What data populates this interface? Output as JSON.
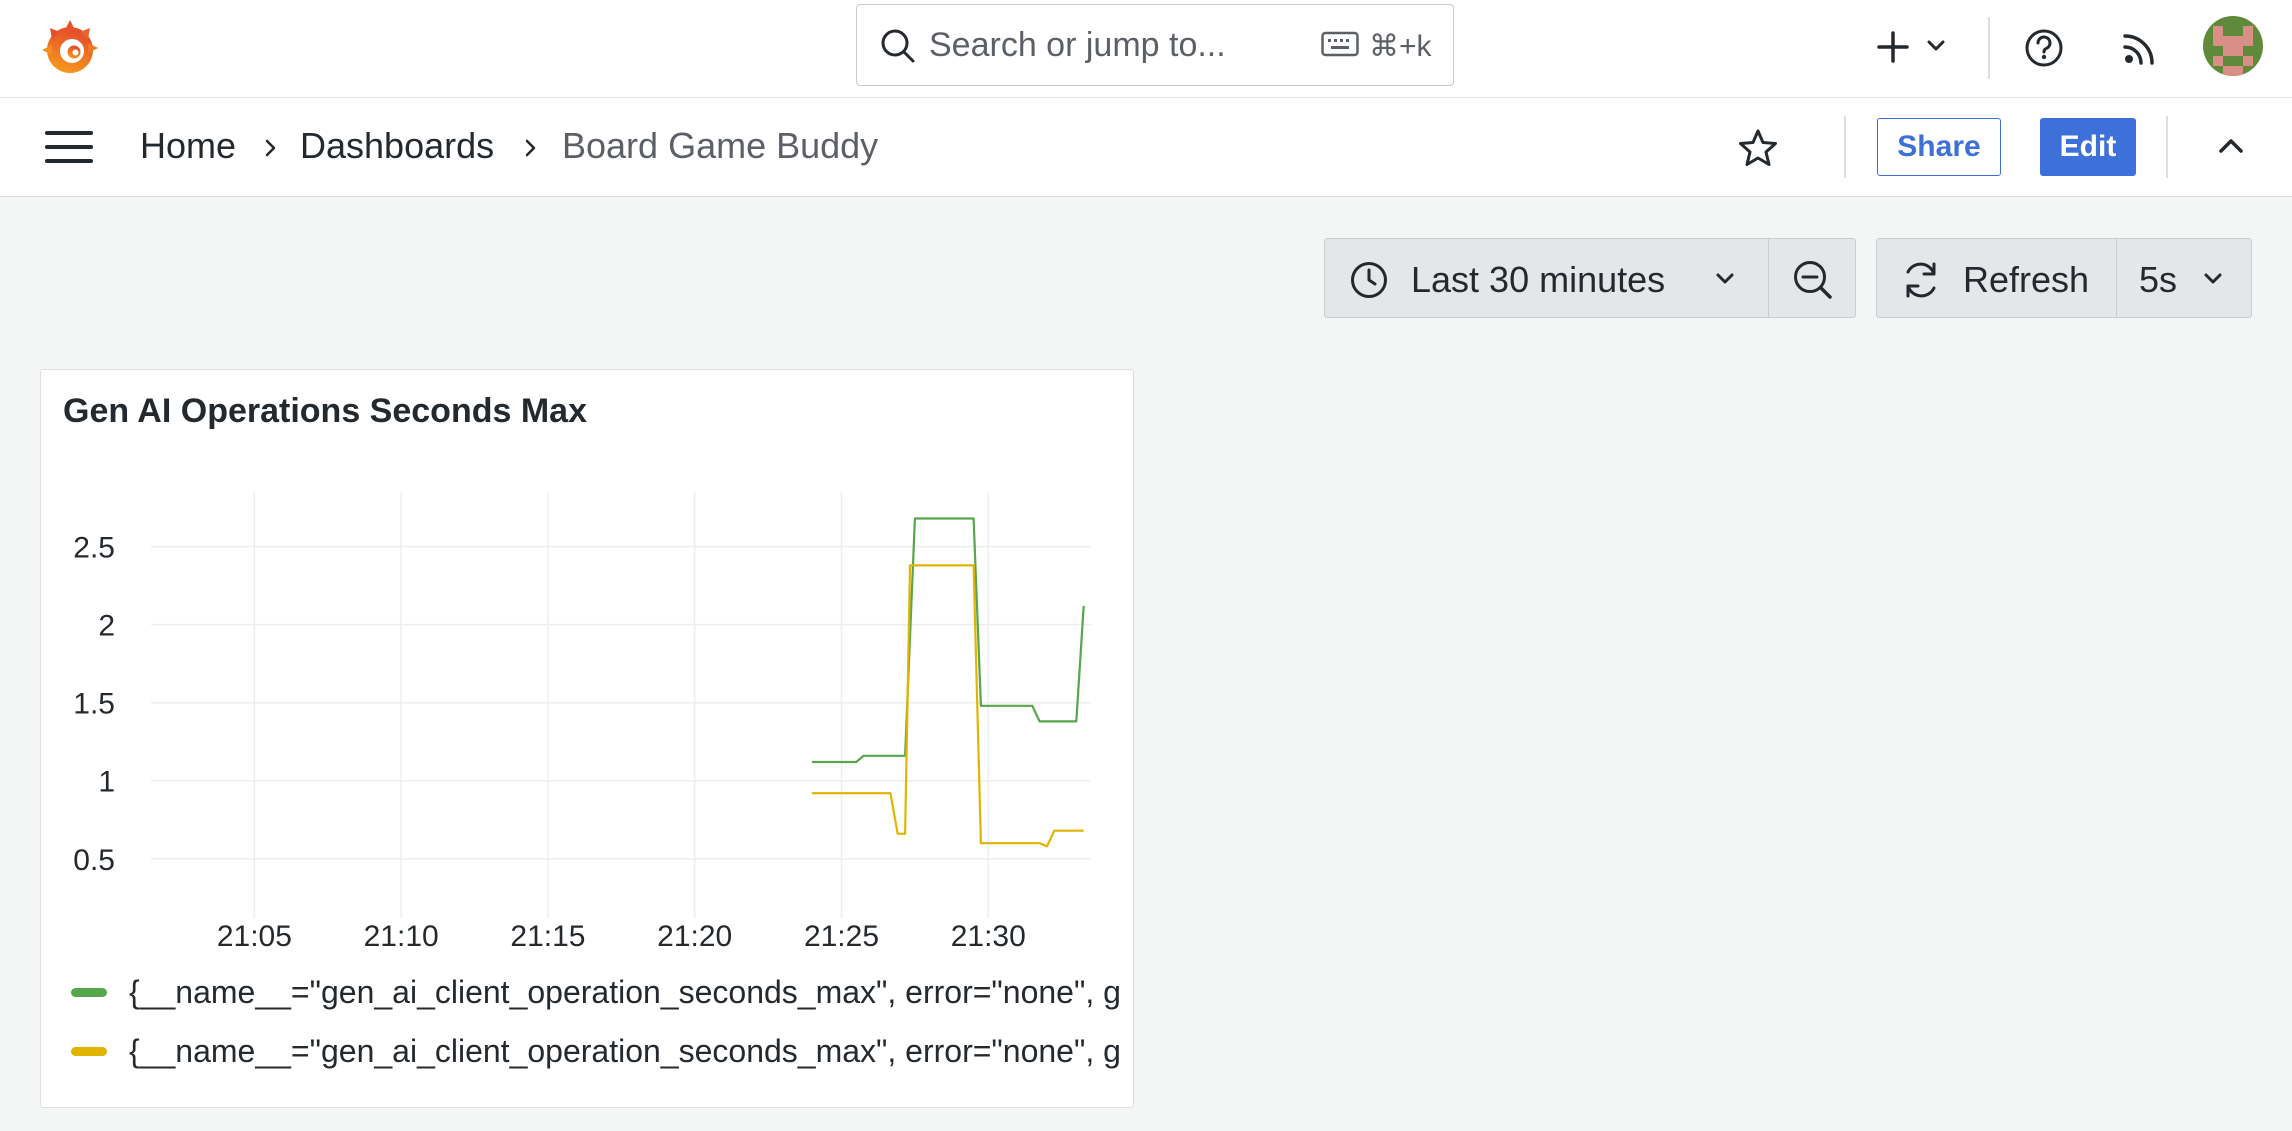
{
  "search": {
    "placeholder": "Search or jump to...",
    "shortcut": "⌘+k"
  },
  "breadcrumb": {
    "items": [
      "Home",
      "Dashboards",
      "Board Game Buddy"
    ]
  },
  "toolbar": {
    "share_label": "Share",
    "edit_label": "Edit"
  },
  "time_controls": {
    "range_label": "Last 30 minutes",
    "refresh_label": "Refresh",
    "interval_label": "5s"
  },
  "panel": {
    "title": "Gen AI Operations Seconds Max",
    "legend": [
      {
        "label": "{__name__=\"gen_ai_client_operation_seconds_max\", error=\"none\", g",
        "color": "#56a64b"
      },
      {
        "label": "{__name__=\"gen_ai_client_operation_seconds_max\", error=\"none\", g",
        "color": "#e0b400"
      }
    ]
  },
  "chart_data": {
    "type": "line",
    "x_ticks": [
      "21:05",
      "21:10",
      "21:15",
      "21:20",
      "21:25",
      "21:30"
    ],
    "y_ticks": [
      "0.5",
      "1",
      "1.5",
      "2",
      "2.5"
    ],
    "xlim": [
      "21:02:30",
      "21:33:30"
    ],
    "ylim": [
      0.3,
      2.85
    ],
    "grid": true,
    "legend_placement": "bottom",
    "series": [
      {
        "color": "#56a64b",
        "points": [
          [
            "21:24:00",
            1.12
          ],
          [
            "21:25:30",
            1.12
          ],
          [
            "21:25:45",
            1.16
          ],
          [
            "21:27:10",
            1.16
          ],
          [
            "21:27:30",
            2.68
          ],
          [
            "21:29:30",
            2.68
          ],
          [
            "21:29:45",
            1.48
          ],
          [
            "21:31:30",
            1.48
          ],
          [
            "21:31:45",
            1.38
          ],
          [
            "21:33:00",
            1.38
          ],
          [
            "21:33:15",
            2.12
          ]
        ]
      },
      {
        "color": "#e0b400",
        "points": [
          [
            "21:24:00",
            0.92
          ],
          [
            "21:26:40",
            0.92
          ],
          [
            "21:26:55",
            0.66
          ],
          [
            "21:27:10",
            0.66
          ],
          [
            "21:27:20",
            2.38
          ],
          [
            "21:29:30",
            2.38
          ],
          [
            "21:29:45",
            0.6
          ],
          [
            "21:31:45",
            0.6
          ],
          [
            "21:32:00",
            0.58
          ],
          [
            "21:32:15",
            0.68
          ],
          [
            "21:33:15",
            0.68
          ]
        ]
      }
    ]
  }
}
